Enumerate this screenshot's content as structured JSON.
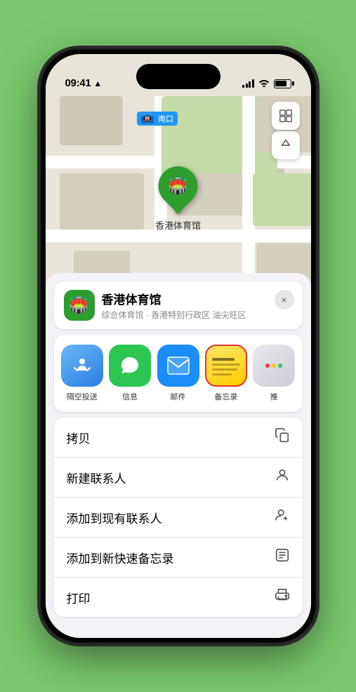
{
  "status_bar": {
    "time": "09:41",
    "time_icon": "location-arrow-icon"
  },
  "map": {
    "subway_label": "南口",
    "location_name": "香港体育馆",
    "pin_emoji": "🏟️",
    "controls": {
      "map_view_icon": "🗺️",
      "location_icon": "↗"
    }
  },
  "venue_card": {
    "name": "香港体育馆",
    "subtitle": "综合体育馆 · 香港特别行政区 油尖旺区",
    "icon_emoji": "🏟️",
    "close_label": "×"
  },
  "share_row": {
    "items": [
      {
        "id": "airdrop",
        "label": "隔空投送",
        "type": "airdrop"
      },
      {
        "id": "messages",
        "label": "信息",
        "type": "messages"
      },
      {
        "id": "mail",
        "label": "邮件",
        "type": "mail"
      },
      {
        "id": "notes",
        "label": "备忘录",
        "type": "notes"
      },
      {
        "id": "more",
        "label": "推",
        "type": "more"
      }
    ]
  },
  "action_rows": [
    {
      "label": "拷贝",
      "icon": "copy"
    },
    {
      "label": "新建联系人",
      "icon": "person"
    },
    {
      "label": "添加到现有联系人",
      "icon": "person-add"
    },
    {
      "label": "添加到新快速备忘录",
      "icon": "note"
    },
    {
      "label": "打印",
      "icon": "printer"
    }
  ]
}
